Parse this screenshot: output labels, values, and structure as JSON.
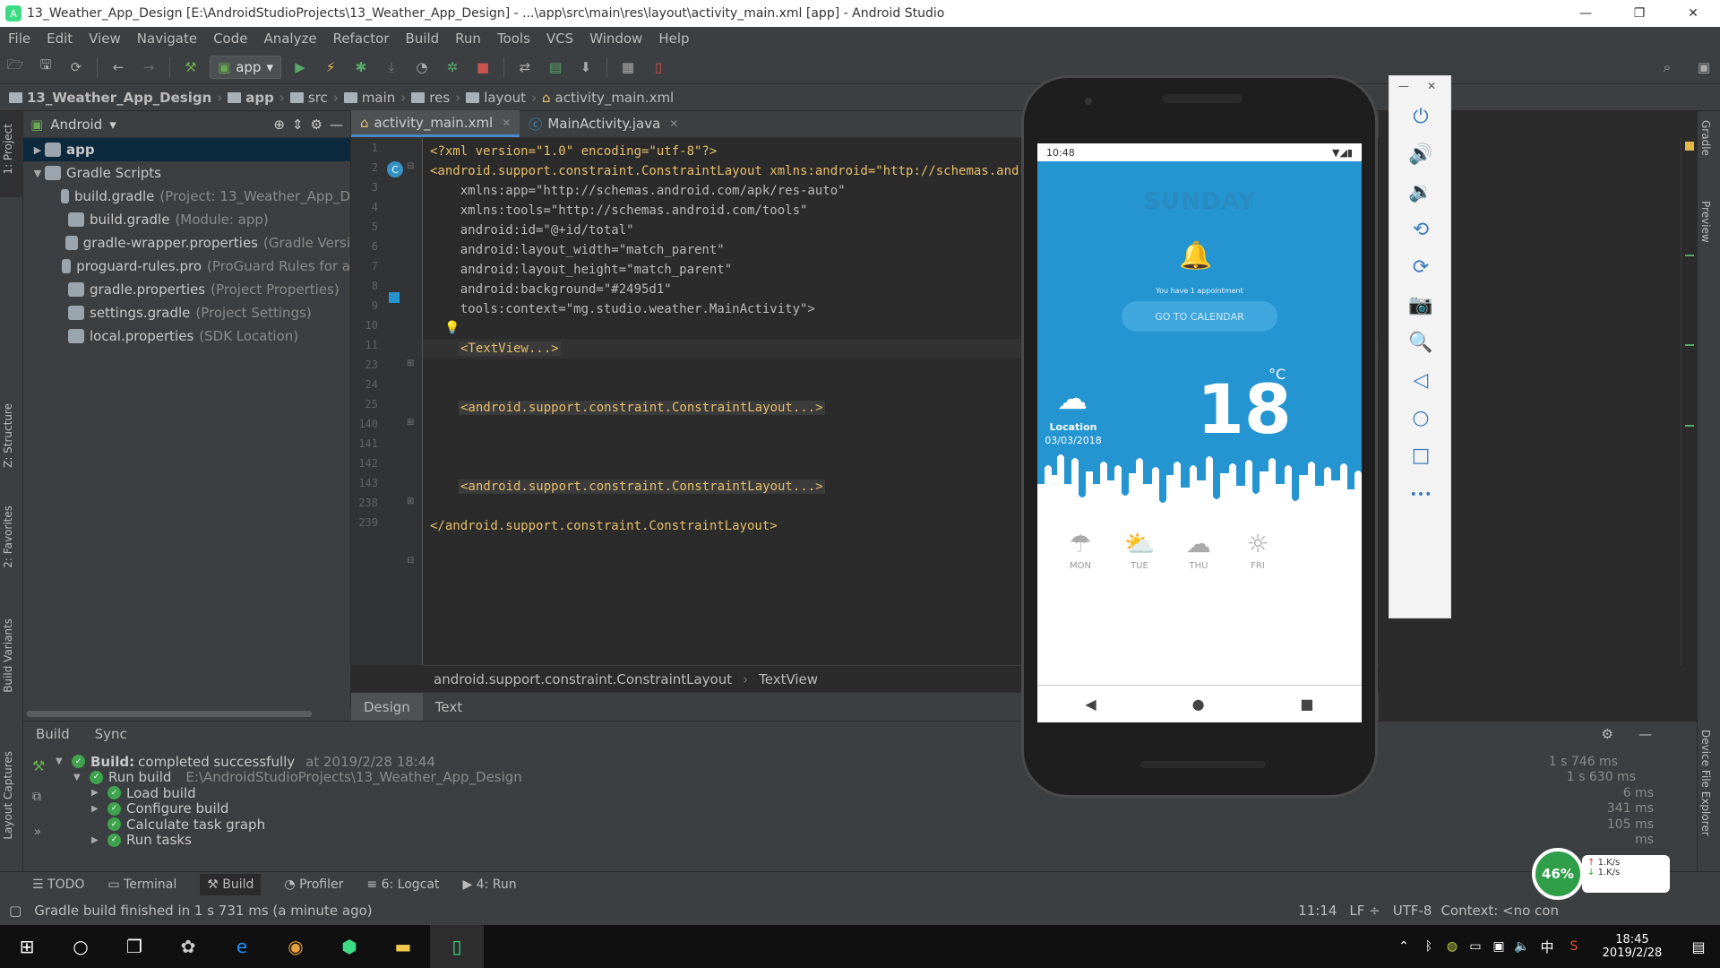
{
  "window": {
    "title": "13_Weather_App_Design [E:\\AndroidStudioProjects\\13_Weather_App_Design] - ...\\app\\src\\main\\res\\layout\\activity_main.xml [app] - Android Studio",
    "minimize": "—",
    "restore": "❐",
    "close": "✕"
  },
  "menu": [
    "File",
    "Edit",
    "View",
    "Navigate",
    "Code",
    "Analyze",
    "Refactor",
    "Build",
    "Run",
    "Tools",
    "VCS",
    "Window",
    "Help"
  ],
  "toolbar": {
    "run_config": "app"
  },
  "breadcrumb": [
    "13_Weather_App_Design",
    "app",
    "src",
    "main",
    "res",
    "layout",
    "activity_main.xml"
  ],
  "left_tabs": {
    "project": "1: Project",
    "structure": "Z: Structure",
    "favorites": "2: Favorites",
    "build_variants": "Build Variants",
    "layout_captures": "Layout Captures"
  },
  "right_tabs": {
    "gradle": "Gradle",
    "preview": "Preview",
    "device_explorer": "Device File Explorer"
  },
  "project": {
    "view": "Android",
    "items": [
      {
        "label": "app",
        "hint": "",
        "level": 0,
        "arrow": "▶",
        "selected": true
      },
      {
        "label": "Gradle Scripts",
        "hint": "",
        "level": 0,
        "arrow": "▼",
        "selected": false
      },
      {
        "label": "build.gradle",
        "hint": "(Project: 13_Weather_App_D",
        "level": 1,
        "arrow": "",
        "selected": false
      },
      {
        "label": "build.gradle",
        "hint": "(Module: app)",
        "level": 1,
        "arrow": "",
        "selected": false
      },
      {
        "label": "gradle-wrapper.properties",
        "hint": "(Gradle Versi",
        "level": 1,
        "arrow": "",
        "selected": false
      },
      {
        "label": "proguard-rules.pro",
        "hint": "(ProGuard Rules for a",
        "level": 1,
        "arrow": "",
        "selected": false
      },
      {
        "label": "gradle.properties",
        "hint": "(Project Properties)",
        "level": 1,
        "arrow": "",
        "selected": false
      },
      {
        "label": "settings.gradle",
        "hint": "(Project Settings)",
        "level": 1,
        "arrow": "",
        "selected": false
      },
      {
        "label": "local.properties",
        "hint": "(SDK Location)",
        "level": 1,
        "arrow": "",
        "selected": false
      }
    ]
  },
  "editor": {
    "tabs": [
      {
        "label": "activity_main.xml",
        "active": true
      },
      {
        "label": "MainActivity.java",
        "active": false
      }
    ],
    "line_numbers": [
      "1",
      "2",
      "3",
      "4",
      "5",
      "6",
      "7",
      "8",
      "9",
      "10",
      "11",
      "23",
      "24",
      "25",
      "140",
      "141",
      "142",
      "143",
      "238",
      "239"
    ],
    "lines": {
      "l1": "<?xml version=\"1.0\" encoding=\"utf-8\"?>",
      "l2": "<android.support.constraint.ConstraintLayout xmlns:android=\"http://schemas.android.",
      "l3": "    xmlns:app=\"http://schemas.android.com/apk/res-auto\"",
      "l4": "    xmlns:tools=\"http://schemas.android.com/tools\"",
      "l5": "    android:id=\"@+id/total\"",
      "l6": "    android:layout_width=\"match_parent\"",
      "l7": "    android:layout_height=\"match_parent\"",
      "l8": "    android:background=\"#2495d1\"",
      "l9": "    tools:context=\"mg.studio.weather.MainActivity\">",
      "l11": "<TextView...>",
      "l25": "<android.support.constraint.ConstraintLayout...>",
      "l143": "<android.support.constraint.ConstraintLayout...>",
      "l239": "</android.support.constraint.ConstraintLayout>"
    },
    "footer_path": [
      "android.support.constraint.ConstraintLayout",
      "TextView"
    ],
    "bottom_tabs": [
      {
        "label": "Design",
        "active": true
      },
      {
        "label": "Text",
        "active": false
      }
    ]
  },
  "build": {
    "tabs": [
      "Build",
      "Sync"
    ],
    "rows": [
      {
        "label": "Build:",
        "label2": "completed successfully",
        "hint": "at 2019/2/28 18:44",
        "time": "1 s 746 ms"
      },
      {
        "label": "Run build",
        "label2": "",
        "hint": "E:\\AndroidStudioProjects\\13_Weather_App_Design",
        "time": "1 s 630 ms"
      },
      {
        "label": "Load build",
        "label2": "",
        "hint": "",
        "time": "6 ms"
      },
      {
        "label": "Configure build",
        "label2": "",
        "hint": "",
        "time": "341 ms"
      },
      {
        "label": "Calculate task graph",
        "label2": "",
        "hint": "",
        "time": "105 ms"
      },
      {
        "label": "Run tasks",
        "label2": "",
        "hint": "",
        "time": "ms"
      }
    ]
  },
  "bottom_tools": [
    "TODO",
    "Terminal",
    "Build",
    "Profiler",
    "6: Logcat",
    "4: Run"
  ],
  "status": {
    "message": "Gradle build finished in 1 s 731 ms (a minute ago)",
    "position": "11:14",
    "line_sep": "LF ÷",
    "encoding": "UTF-8",
    "context": "Context: <no con"
  },
  "phone": {
    "status_time": "10:48",
    "day": "SUNDAY",
    "appointment": "You have 1 appointment",
    "calendar_button": "GO TO CALENDAR",
    "location": "Location",
    "date": "03/03/2018",
    "temperature": "18",
    "unit": "°C",
    "forecast": [
      "MON",
      "TUE",
      "THU",
      "FRI"
    ],
    "bg_color": "#2495d1"
  },
  "emulator": {
    "close": "✕",
    "minimize": "—",
    "more": "•••"
  },
  "widget": {
    "percent": "46%",
    "up": "↑",
    "down": "↓",
    "up_speed": "1.K/s",
    "down_speed": "1.K/s"
  },
  "taskbar": {
    "time": "18:45",
    "date": "2019/2/28",
    "ime": "中"
  }
}
